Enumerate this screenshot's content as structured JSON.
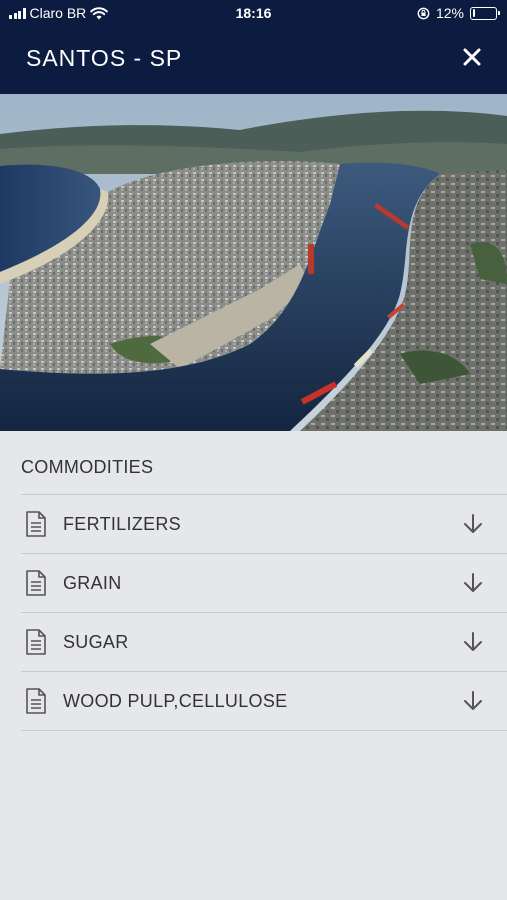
{
  "status_bar": {
    "carrier": "Claro BR",
    "time": "18:16",
    "battery": "12%",
    "battery_level": 0.12
  },
  "header": {
    "title": "SANTOS - SP",
    "close_icon": "close-icon"
  },
  "photo": {
    "icon": "aerial-port-photo"
  },
  "section": {
    "title": "COMMODITIES"
  },
  "commodities": [
    {
      "label": "FERTILIZERS",
      "icon": "document-icon",
      "action_icon": "download-arrow-icon"
    },
    {
      "label": "GRAIN",
      "icon": "document-icon",
      "action_icon": "download-arrow-icon"
    },
    {
      "label": "SUGAR",
      "icon": "document-icon",
      "action_icon": "download-arrow-icon"
    },
    {
      "label": "WOOD PULP,CELLULOSE",
      "icon": "document-icon",
      "action_icon": "download-arrow-icon"
    }
  ],
  "colors": {
    "header_bg": "#0c1b40",
    "page_bg": "#e6e7eb",
    "text": "#333333",
    "divider": "#c8c9cd"
  }
}
